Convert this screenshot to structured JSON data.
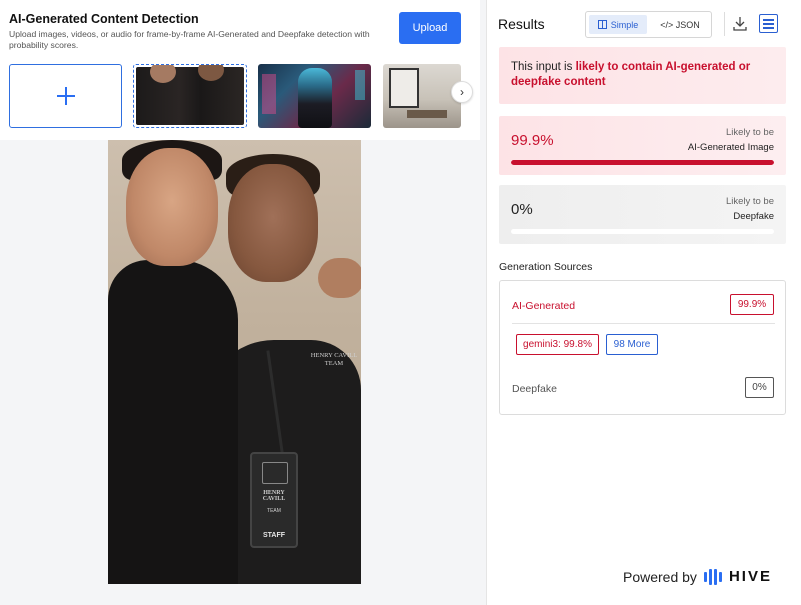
{
  "header": {
    "title": "AI-Generated Content Detection",
    "description": "Upload images, videos, or audio for frame-by-frame AI-Generated and Deepfake detection with probability scores.",
    "upload_label": "Upload"
  },
  "thumbnails": [
    {
      "name": "add-media",
      "icon": "plus-icon"
    },
    {
      "name": "two-men-photo",
      "selected": true
    },
    {
      "name": "cyber-woman-image"
    },
    {
      "name": "interior-room-image"
    }
  ],
  "photo": {
    "shirt_text": "HENRY CAVILL TEAM",
    "badge_title": "HENRY CAVILL",
    "badge_sub": "TEAM",
    "badge_role": "STAFF"
  },
  "results": {
    "title": "Results",
    "view_simple": "Simple",
    "view_json": "</> JSON",
    "verdict_prefix": "This input is ",
    "verdict_highlight": "likely to contain AI-generated or deepfake content",
    "ai": {
      "score": "99.9%",
      "label_top": "Likely to be",
      "label_bottom": "AI-Generated Image",
      "fraction": 0.999
    },
    "deepfake": {
      "score": "0%",
      "label_top": "Likely to be",
      "label_bottom": "Deepfake",
      "fraction": 0.0
    },
    "sources_title": "Generation Sources",
    "sources": {
      "ai_label": "AI-Generated",
      "ai_value": "99.9%",
      "top_source": "gemini3: 99.8%",
      "more_label": "98 More",
      "deepfake_label": "Deepfake",
      "deepfake_value": "0%"
    },
    "powered_by": "Powered by",
    "brand": "HIVE"
  },
  "colors": {
    "accent": "#2a6ef2",
    "alert_red": "#c8102e",
    "alert_bg": "#fde3e6"
  }
}
